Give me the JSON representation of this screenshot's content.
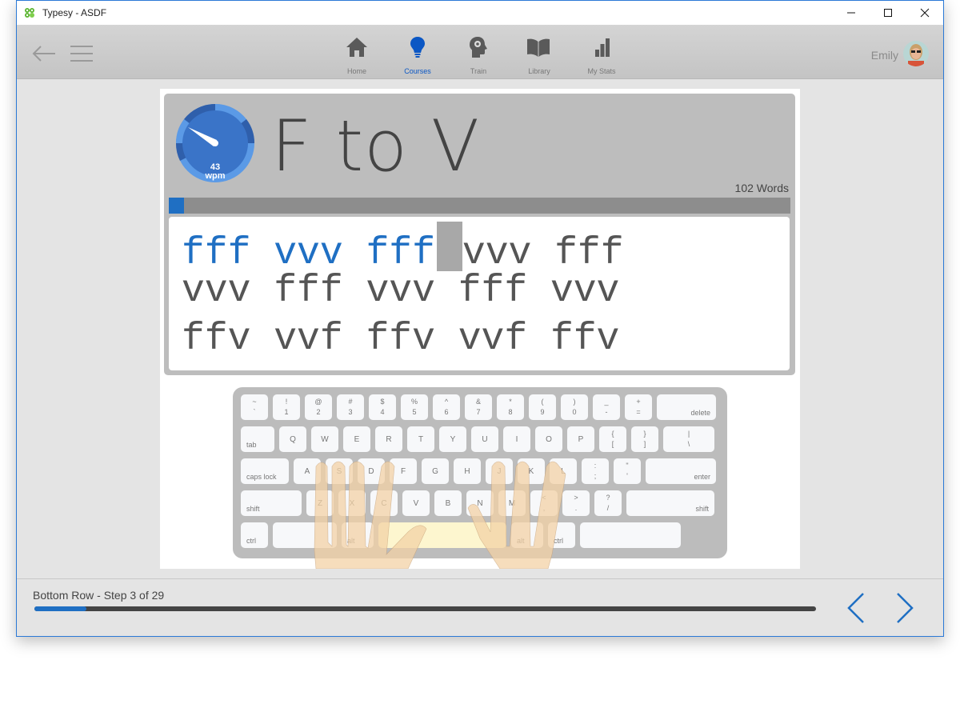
{
  "window": {
    "title": "Typesy - ASDF",
    "controls": {
      "minimize": "minimize-icon",
      "maximize": "maximize-icon",
      "close": "close-icon"
    }
  },
  "header": {
    "back_icon": "arrow-left-icon",
    "menu_icon": "hamburger-icon",
    "nav": [
      {
        "label": "Home",
        "icon": "home-icon",
        "active": false
      },
      {
        "label": "Courses",
        "icon": "lightbulb-icon",
        "active": true
      },
      {
        "label": "Train",
        "icon": "brain-gear-icon",
        "active": false
      },
      {
        "label": "Library",
        "icon": "book-icon",
        "active": false
      },
      {
        "label": "My Stats",
        "icon": "bar-chart-icon",
        "active": false
      }
    ],
    "user": {
      "name": "Emily"
    }
  },
  "lesson": {
    "title": "F to V",
    "speed": {
      "value": "43",
      "unit": "wpm"
    },
    "word_count": "102 Words",
    "progress_fraction": 0.025,
    "lines": [
      {
        "words": [
          "fff",
          "vvv",
          "fff",
          "vvv",
          "fff"
        ],
        "typed_words": 3
      },
      {
        "words": [
          "vvv",
          "fff",
          "vvv",
          "fff",
          "vvv"
        ],
        "typed_words": 0
      },
      {
        "words": [
          "ffv",
          "vvf",
          "ffv",
          "vvf",
          "ffv"
        ],
        "typed_words": 0
      }
    ]
  },
  "keyboard": {
    "rows": [
      [
        [
          "~",
          "`"
        ],
        [
          "!",
          "1"
        ],
        [
          "@",
          "2"
        ],
        [
          "#",
          "3"
        ],
        [
          "$",
          "4"
        ],
        [
          "%",
          "5"
        ],
        [
          "^",
          "6"
        ],
        [
          "&",
          "7"
        ],
        [
          "*",
          "8"
        ],
        [
          "(",
          "9"
        ],
        [
          ")",
          "0"
        ],
        [
          "_",
          "-"
        ],
        [
          "+",
          "="
        ],
        [
          "",
          "delete"
        ]
      ],
      [
        [
          "",
          "tab"
        ],
        [
          "",
          "Q"
        ],
        [
          "",
          "W"
        ],
        [
          "",
          "E"
        ],
        [
          "",
          "R"
        ],
        [
          "",
          "T"
        ],
        [
          "",
          "Y"
        ],
        [
          "",
          "U"
        ],
        [
          "",
          "I"
        ],
        [
          "",
          "O"
        ],
        [
          "",
          "P"
        ],
        [
          "{",
          "["
        ],
        [
          "}",
          "]"
        ],
        [
          "|",
          "\\"
        ]
      ],
      [
        [
          "",
          "caps lock"
        ],
        [
          "",
          "A"
        ],
        [
          "",
          "S"
        ],
        [
          "",
          "D"
        ],
        [
          "",
          "F"
        ],
        [
          "",
          "G"
        ],
        [
          "",
          "H"
        ],
        [
          "",
          "J"
        ],
        [
          "",
          "K"
        ],
        [
          "",
          "L"
        ],
        [
          ":",
          ";"
        ],
        [
          "\"",
          "'"
        ],
        [
          "",
          "enter"
        ]
      ],
      [
        [
          "",
          "shift"
        ],
        [
          "",
          "Z"
        ],
        [
          "",
          "X"
        ],
        [
          "",
          "C"
        ],
        [
          "",
          "V"
        ],
        [
          "",
          "B"
        ],
        [
          "",
          "N"
        ],
        [
          "",
          "M"
        ],
        [
          "<",
          ","
        ],
        [
          ">",
          "."
        ],
        [
          "?",
          "/"
        ],
        [
          "",
          "shift"
        ]
      ],
      [
        [
          "",
          "ctrl"
        ],
        [
          "",
          ""
        ],
        [
          "",
          "alt"
        ],
        [
          "",
          ""
        ],
        [
          "",
          "alt"
        ],
        [
          "",
          "ctrl"
        ],
        [
          "",
          ""
        ]
      ]
    ]
  },
  "footer": {
    "step_text": "Bottom Row - Step 3 of 29",
    "progress_fraction": 0.067,
    "prev_icon": "chevron-left-icon",
    "next_icon": "chevron-right-icon"
  },
  "colors": {
    "accent": "#1f6fc3",
    "active_nav": "#0b57c4",
    "gauge_blue": "#3a74c8",
    "text_dark": "#444444"
  }
}
